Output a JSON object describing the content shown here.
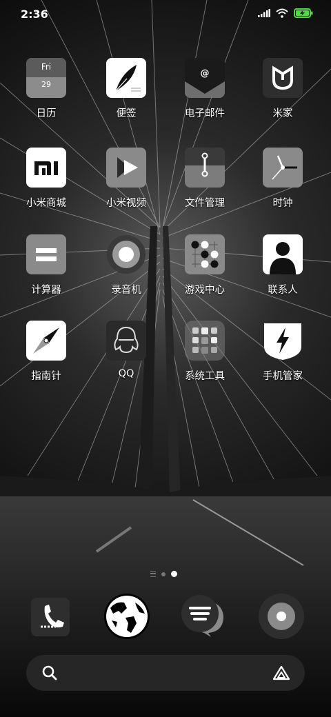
{
  "status": {
    "time": "2:36"
  },
  "apps": [
    {
      "name": "calendar",
      "label": "日历",
      "day": "Fri",
      "date": "29"
    },
    {
      "name": "notes",
      "label": "便签"
    },
    {
      "name": "email",
      "label": "电子邮件"
    },
    {
      "name": "mi-home",
      "label": "米家"
    },
    {
      "name": "mi-store",
      "label": "小米商城"
    },
    {
      "name": "mi-video",
      "label": "小米视频"
    },
    {
      "name": "file-manager",
      "label": "文件管理"
    },
    {
      "name": "clock",
      "label": "时钟"
    },
    {
      "name": "calculator",
      "label": "计算器"
    },
    {
      "name": "recorder",
      "label": "录音机"
    },
    {
      "name": "game-center",
      "label": "游戏中心"
    },
    {
      "name": "contacts",
      "label": "联系人"
    },
    {
      "name": "compass",
      "label": "指南针"
    },
    {
      "name": "qq",
      "label": "QQ"
    },
    {
      "name": "system-tools",
      "label": "系统工具"
    },
    {
      "name": "security",
      "label": "手机管家"
    }
  ],
  "pager": {
    "current": 2
  },
  "dock": [
    "phone",
    "browser",
    "messages",
    "music"
  ],
  "search": {
    "icons": [
      "search-icon",
      "assistant-icon"
    ]
  }
}
